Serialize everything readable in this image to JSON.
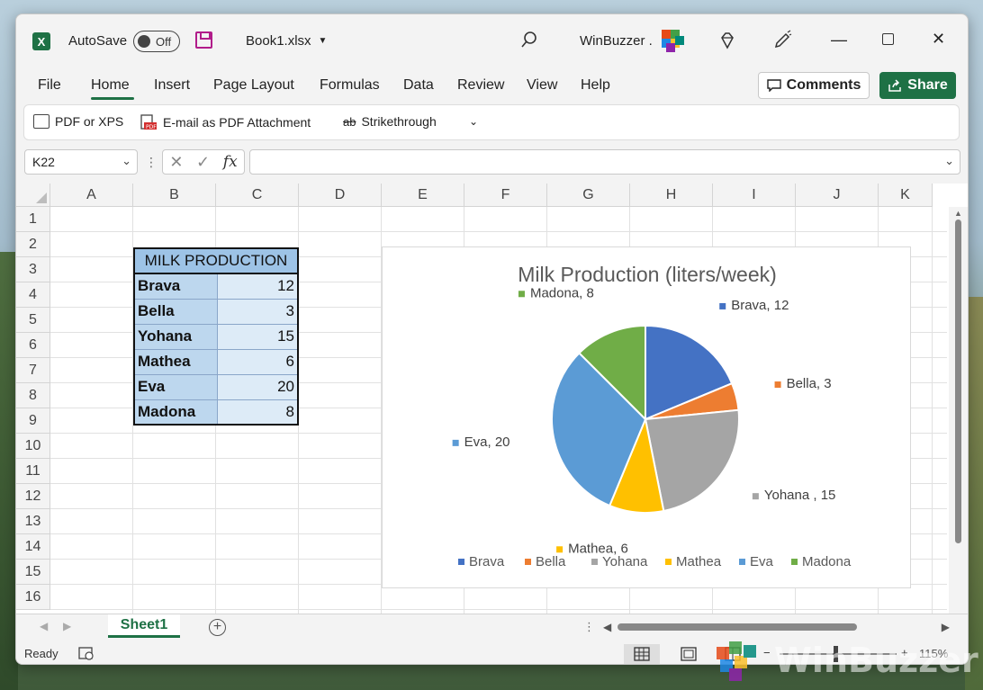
{
  "window": {
    "autosave_label": "AutoSave",
    "autosave_state": "Off",
    "file_name": "Book1.xlsx",
    "user_name": "WinBuzzer .",
    "accent_color": "#1e7145"
  },
  "menu": {
    "items": [
      "File",
      "Home",
      "Insert",
      "Page Layout",
      "Formulas",
      "Data",
      "Review",
      "View",
      "Help"
    ],
    "comments_label": "Comments",
    "share_label": "Share"
  },
  "quick_access": {
    "pdf_xps_label": "PDF or XPS",
    "email_pdf_label": "E-mail as PDF Attachment",
    "strikethrough_label": "Strikethrough"
  },
  "formula_bar": {
    "name_box": "K22",
    "fx_label": "fx",
    "formula_value": ""
  },
  "grid": {
    "columns": [
      "A",
      "B",
      "C",
      "D",
      "E",
      "F",
      "G",
      "H",
      "I",
      "J",
      "K"
    ],
    "rows": [
      "1",
      "2",
      "3",
      "4",
      "5",
      "6",
      "7",
      "8",
      "9",
      "10",
      "11",
      "12",
      "13",
      "14",
      "15",
      "16"
    ],
    "table_header": "MILK PRODUCTION",
    "table_rows": [
      {
        "name": "Brava",
        "value": "12"
      },
      {
        "name": "Bella",
        "value": "3"
      },
      {
        "name": "Yohana",
        "value": "15"
      },
      {
        "name": "Mathea",
        "value": "6"
      },
      {
        "name": "Eva",
        "value": "20"
      },
      {
        "name": "Madona",
        "value": "8"
      }
    ]
  },
  "chart_data": {
    "type": "pie",
    "title": "Milk Production (liters/week)",
    "categories": [
      "Brava",
      "Bella",
      "Yohana",
      "Mathea",
      "Eva",
      "Madona"
    ],
    "values": [
      12,
      3,
      15,
      6,
      20,
      8
    ],
    "data_labels": [
      "Brava, 12",
      "Bella, 3",
      "Yohana , 15",
      "Mathea, 6",
      "Eva, 20",
      "Madona, 8"
    ],
    "colors": [
      "#4472c4",
      "#ed7d31",
      "#a5a5a5",
      "#ffc000",
      "#5b9bd5",
      "#70ad47"
    ],
    "legend": "bottom"
  },
  "sheet_tabs": {
    "active": "Sheet1"
  },
  "status": {
    "ready_label": "Ready",
    "zoom_label": "115%",
    "zoom_minus": "−",
    "zoom_plus": "+"
  },
  "watermark": {
    "text": "WinBuzzer"
  }
}
